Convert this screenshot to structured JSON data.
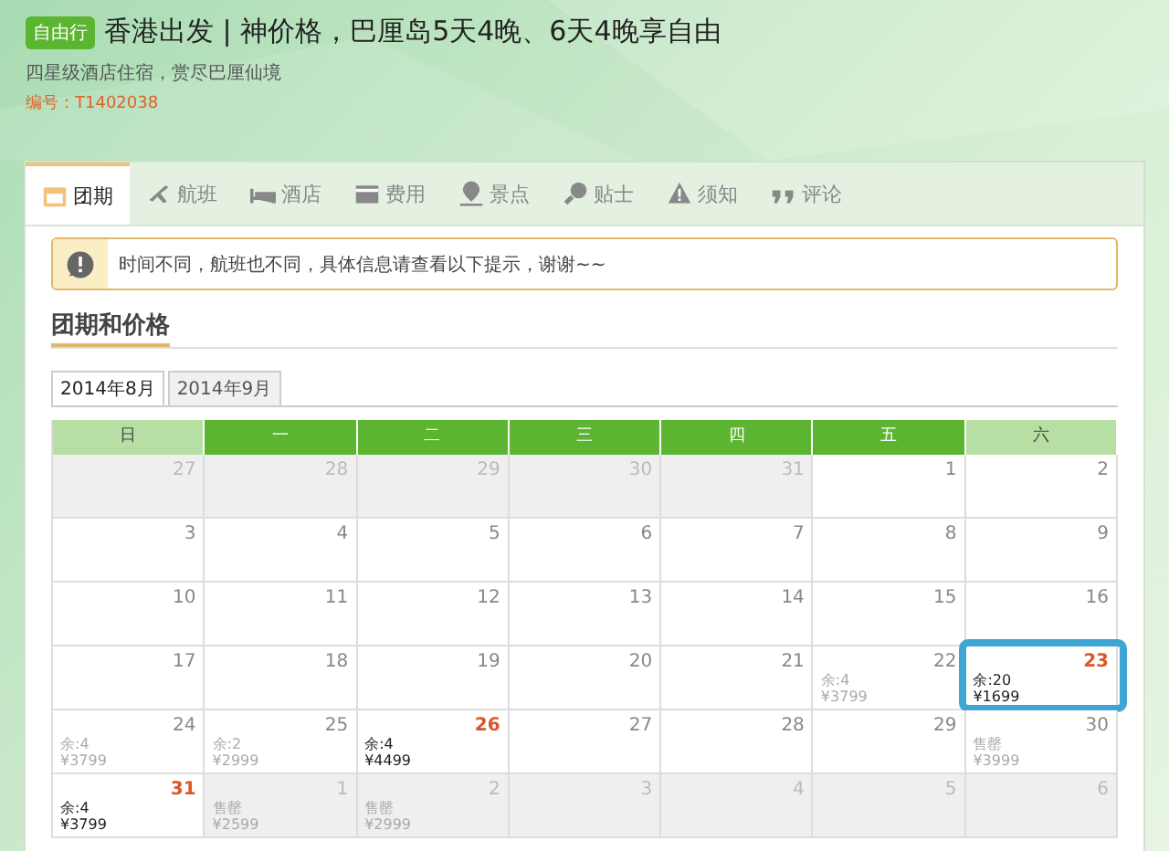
{
  "header": {
    "badge": "自由行",
    "title": "香港出发 | 神价格，巴厘岛5天4晚、6天4晚享自由",
    "subtitle": "四星级酒店住宿，赏尽巴厘仙境",
    "code": "编号：T1402038"
  },
  "tabs": [
    {
      "label": "团期",
      "selected": true
    },
    {
      "label": "航班",
      "selected": false
    },
    {
      "label": "酒店",
      "selected": false
    },
    {
      "label": "费用",
      "selected": false
    },
    {
      "label": "景点",
      "selected": false
    },
    {
      "label": "贴士",
      "selected": false
    },
    {
      "label": "须知",
      "selected": false
    },
    {
      "label": "评论",
      "selected": false
    }
  ],
  "notice": "时间不同，航班也不同，具体信息请查看以下提示，谢谢~~",
  "section_title": "团期和价格",
  "month_tabs": [
    {
      "label": "2014年8月",
      "selected": true
    },
    {
      "label": "2014年9月",
      "selected": false
    }
  ],
  "weekdays": [
    {
      "label": "日",
      "weekend": true
    },
    {
      "label": "一",
      "weekend": false
    },
    {
      "label": "二",
      "weekend": false
    },
    {
      "label": "三",
      "weekend": false
    },
    {
      "label": "四",
      "weekend": false
    },
    {
      "label": "五",
      "weekend": false
    },
    {
      "label": "六",
      "weekend": true
    }
  ],
  "weeks": [
    [
      {
        "day": "27",
        "kind": "other"
      },
      {
        "day": "28",
        "kind": "other"
      },
      {
        "day": "29",
        "kind": "other"
      },
      {
        "day": "30",
        "kind": "other"
      },
      {
        "day": "31",
        "kind": "other"
      },
      {
        "day": "1",
        "kind": "past"
      },
      {
        "day": "2",
        "kind": "past"
      }
    ],
    [
      {
        "day": "3",
        "kind": "past"
      },
      {
        "day": "4",
        "kind": "past"
      },
      {
        "day": "5",
        "kind": "past"
      },
      {
        "day": "6",
        "kind": "past"
      },
      {
        "day": "7",
        "kind": "past"
      },
      {
        "day": "8",
        "kind": "past"
      },
      {
        "day": "9",
        "kind": "past"
      }
    ],
    [
      {
        "day": "10",
        "kind": "past"
      },
      {
        "day": "11",
        "kind": "past"
      },
      {
        "day": "12",
        "kind": "past"
      },
      {
        "day": "13",
        "kind": "past"
      },
      {
        "day": "14",
        "kind": "past"
      },
      {
        "day": "15",
        "kind": "past"
      },
      {
        "day": "16",
        "kind": "past"
      }
    ],
    [
      {
        "day": "17",
        "kind": "past"
      },
      {
        "day": "18",
        "kind": "past"
      },
      {
        "day": "19",
        "kind": "past"
      },
      {
        "day": "20",
        "kind": "past"
      },
      {
        "day": "21",
        "kind": "past"
      },
      {
        "day": "22",
        "kind": "past",
        "seats": "余:4",
        "price": "¥3799"
      },
      {
        "day": "23",
        "kind": "open",
        "seats": "余:20",
        "price": "¥1699",
        "highlighted": true
      }
    ],
    [
      {
        "day": "24",
        "kind": "past",
        "seats": "余:4",
        "price": "¥3799"
      },
      {
        "day": "25",
        "kind": "past",
        "seats": "余:2",
        "price": "¥2999"
      },
      {
        "day": "26",
        "kind": "open",
        "seats": "余:4",
        "price": "¥4499"
      },
      {
        "day": "27",
        "kind": "past"
      },
      {
        "day": "28",
        "kind": "past"
      },
      {
        "day": "29",
        "kind": "past"
      },
      {
        "day": "30",
        "kind": "past",
        "seats": "售罄",
        "price": "¥3999"
      }
    ],
    [
      {
        "day": "31",
        "kind": "open",
        "seats": "余:4",
        "price": "¥3799"
      },
      {
        "day": "1",
        "kind": "other",
        "seats": "售罄",
        "price": "¥2599"
      },
      {
        "day": "2",
        "kind": "other",
        "seats": "售罄",
        "price": "¥2999"
      },
      {
        "day": "3",
        "kind": "other"
      },
      {
        "day": "4",
        "kind": "other"
      },
      {
        "day": "5",
        "kind": "other"
      },
      {
        "day": "6",
        "kind": "other"
      }
    ]
  ]
}
